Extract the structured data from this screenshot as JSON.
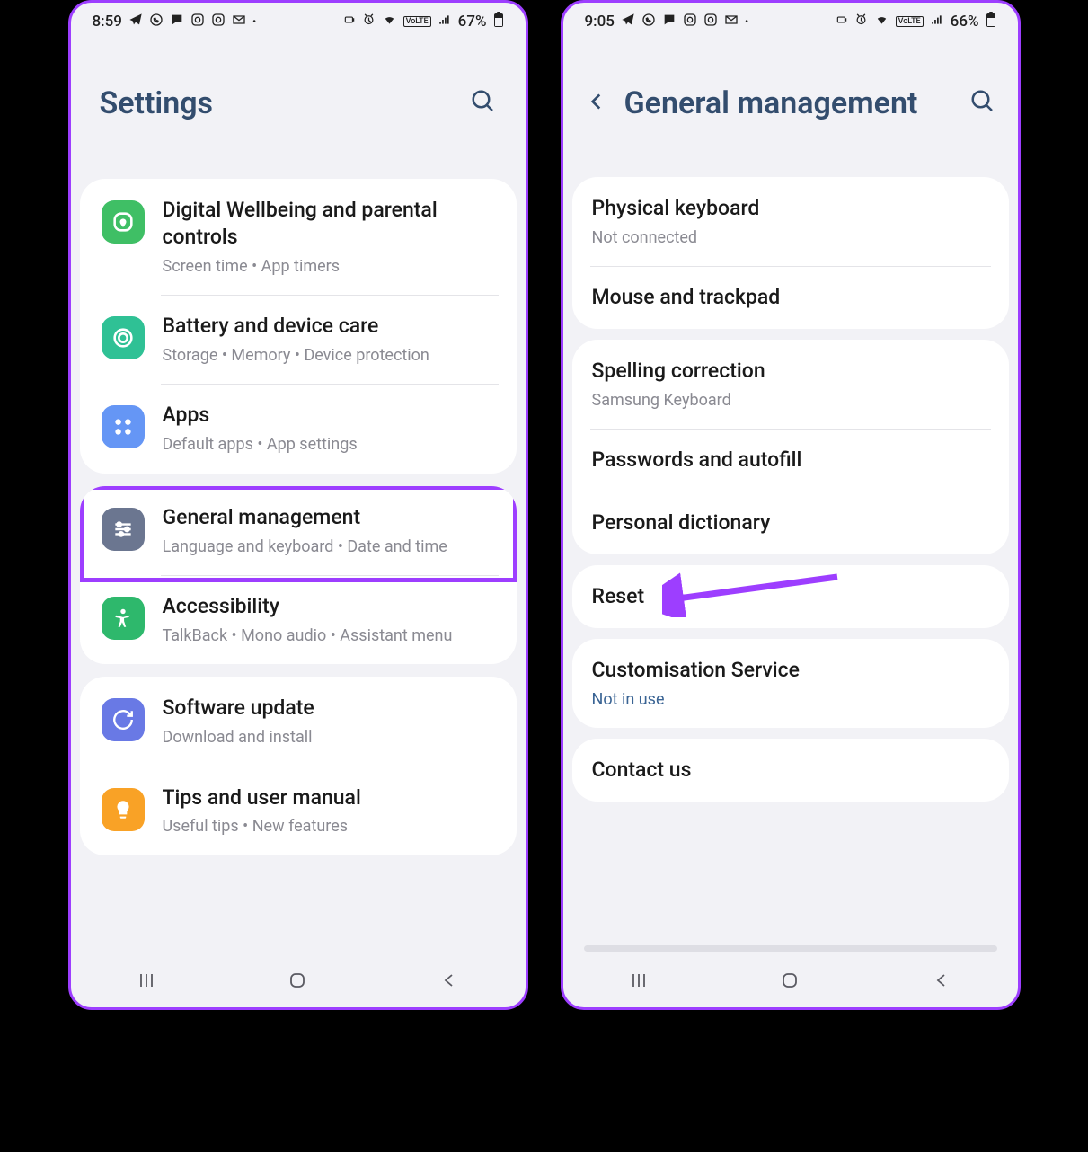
{
  "left": {
    "status": {
      "time": "8:59",
      "battery": "67%"
    },
    "header_title": "Settings",
    "sections": [
      {
        "items": [
          {
            "title": "Digital Wellbeing and parental controls",
            "subtitle": "Screen time  •  App timers",
            "icon_bg": "#3fbf65",
            "icon": "wellbeing"
          },
          {
            "title": "Battery and device care",
            "subtitle": "Storage  •  Memory  •  Device protection",
            "icon_bg": "#2fc195",
            "icon": "care"
          },
          {
            "title": "Apps",
            "subtitle": "Default apps  •  App settings",
            "icon_bg": "#6596f5",
            "icon": "apps"
          }
        ]
      },
      {
        "items": [
          {
            "title": "General management",
            "subtitle": "Language and keyboard  •  Date and time",
            "icon_bg": "#6b7690",
            "icon": "sliders"
          },
          {
            "title": "Accessibility",
            "subtitle": "TalkBack  •  Mono audio  •  Assistant menu",
            "icon_bg": "#2eb86c",
            "icon": "a11y"
          }
        ]
      },
      {
        "items": [
          {
            "title": "Software update",
            "subtitle": "Download and install",
            "icon_bg": "#6979e5",
            "icon": "update"
          },
          {
            "title": "Tips and user manual",
            "subtitle": "Useful tips  •  New features",
            "icon_bg": "#f9a226",
            "icon": "tips"
          }
        ]
      }
    ]
  },
  "right": {
    "status": {
      "time": "9:05",
      "battery": "66%"
    },
    "header_title": "General management",
    "sections": [
      {
        "items": [
          {
            "title": "Physical keyboard",
            "subtitle": "Not connected"
          },
          {
            "title": "Mouse and trackpad"
          }
        ]
      },
      {
        "items": [
          {
            "title": "Spelling correction",
            "subtitle": "Samsung Keyboard"
          },
          {
            "title": "Passwords and autofill"
          },
          {
            "title": "Personal dictionary"
          }
        ]
      },
      {
        "items": [
          {
            "title": "Reset"
          }
        ]
      },
      {
        "items": [
          {
            "title": "Customisation Service",
            "subtitle": "Not in use",
            "subtitle_link": true
          }
        ]
      },
      {
        "items": [
          {
            "title": "Contact us"
          }
        ]
      }
    ]
  }
}
